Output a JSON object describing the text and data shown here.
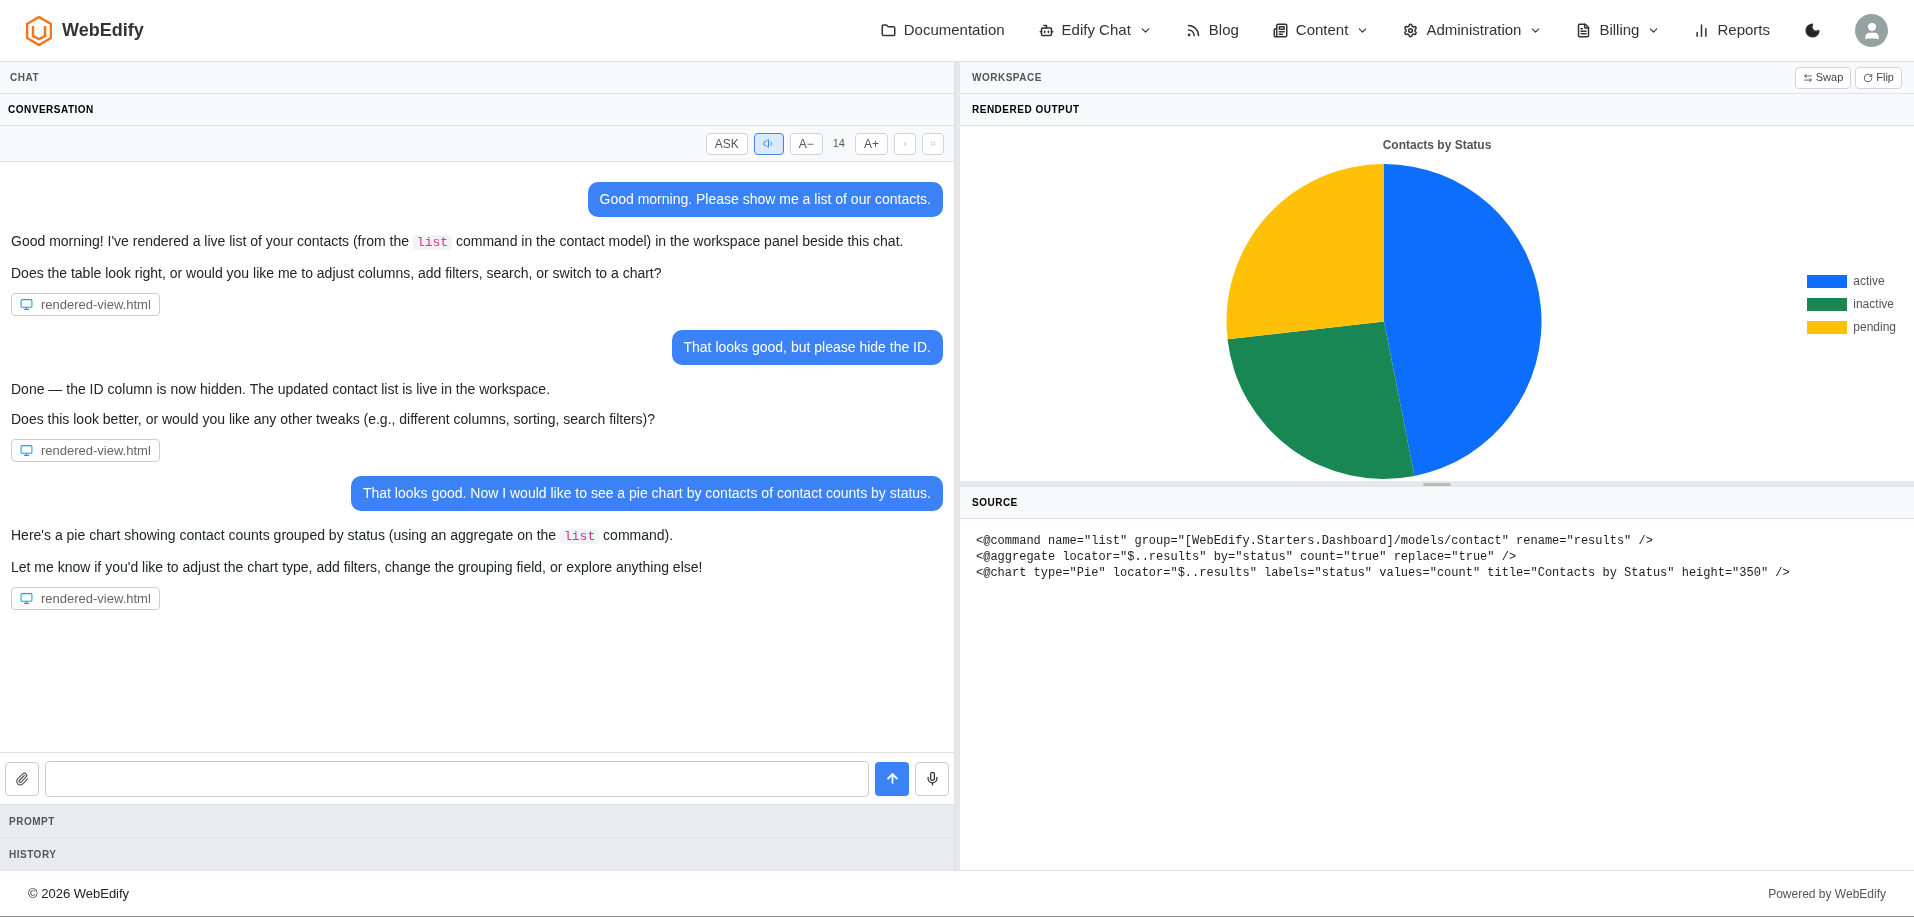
{
  "brand": {
    "name": "WebEdify"
  },
  "nav": [
    {
      "label": "Documentation",
      "dropdown": false
    },
    {
      "label": "Edify Chat",
      "dropdown": true
    },
    {
      "label": "Blog",
      "dropdown": false
    },
    {
      "label": "Content",
      "dropdown": true
    },
    {
      "label": "Administration",
      "dropdown": true
    },
    {
      "label": "Billing",
      "dropdown": true
    },
    {
      "label": "Reports",
      "dropdown": false
    }
  ],
  "chat": {
    "title": "CHAT",
    "section": "CONVERSATION",
    "toolbar": [
      {
        "kind": "text",
        "label": "ASK",
        "selected": false
      },
      {
        "kind": "speaker",
        "selected": true
      },
      {
        "kind": "text",
        "label": "A−",
        "selected": false
      },
      {
        "kind": "value",
        "label": "14"
      },
      {
        "kind": "text",
        "label": "A+",
        "selected": false
      },
      {
        "kind": "height",
        "selected": false
      },
      {
        "kind": "expand",
        "selected": false
      }
    ],
    "messages": [
      {
        "kind": "user",
        "text": "Good morning. Please show me a list of our contacts."
      },
      {
        "kind": "assistant",
        "paragraphs": [
          [
            "Good morning! I've rendered a live list of your contacts (from the ",
            "list",
            " command in the contact model) in the workspace panel beside this chat."
          ],
          [
            "Does the table look right, or would you like me to adjust columns, add filters, search, or switch to a chart?"
          ]
        ],
        "attachment": "rendered-view.html"
      },
      {
        "kind": "user",
        "text": "That looks good, but please hide the ID."
      },
      {
        "kind": "assistant",
        "paragraphs": [
          [
            "Done — the ID column is now hidden. The updated contact list is live in the workspace."
          ],
          [
            "Does this look better, or would you like any other tweaks (e.g., different columns, sorting, search filters)?"
          ]
        ],
        "attachment": "rendered-view.html"
      },
      {
        "kind": "user",
        "text": "That looks good. Now I would like to see a pie chart by contacts of contact counts by status."
      },
      {
        "kind": "assistant",
        "paragraphs": [
          [
            "Here's a pie chart showing contact counts grouped by status (using an aggregate on the ",
            "list",
            " command)."
          ],
          [
            "Let me know if you'd like to adjust the chart type, add filters, change the grouping field, or explore anything else!"
          ]
        ],
        "attachment": "rendered-view.html"
      }
    ],
    "panels": [
      "PROMPT",
      "HISTORY"
    ]
  },
  "workspace": {
    "title": "WORKSPACE",
    "buttons": [
      {
        "label": "Swap"
      },
      {
        "label": "Flip"
      }
    ],
    "output_title": "RENDERED OUTPUT",
    "chart": {
      "title": "Contacts by Status",
      "legend": [
        {
          "label": "active",
          "color": "#0d6efd"
        },
        {
          "label": "inactive",
          "color": "#198754"
        },
        {
          "label": "pending",
          "color": "#ffc107"
        }
      ]
    },
    "source_title": "SOURCE",
    "source": [
      "<@command name=\"list\" group=\"[WebEdify.Starters.Dashboard]/models/contact\" rename=\"results\" />",
      "<@aggregate locator=\"$..results\" by=\"status\" count=\"true\" replace=\"true\" />",
      "<@chart type=\"Pie\" locator=\"$..results\" labels=\"status\" values=\"count\" title=\"Contacts by Status\" height=\"350\" />"
    ]
  },
  "footer": {
    "copyright": "© 2026 WebEdify",
    "powered": "Powered by WebEdify"
  }
}
